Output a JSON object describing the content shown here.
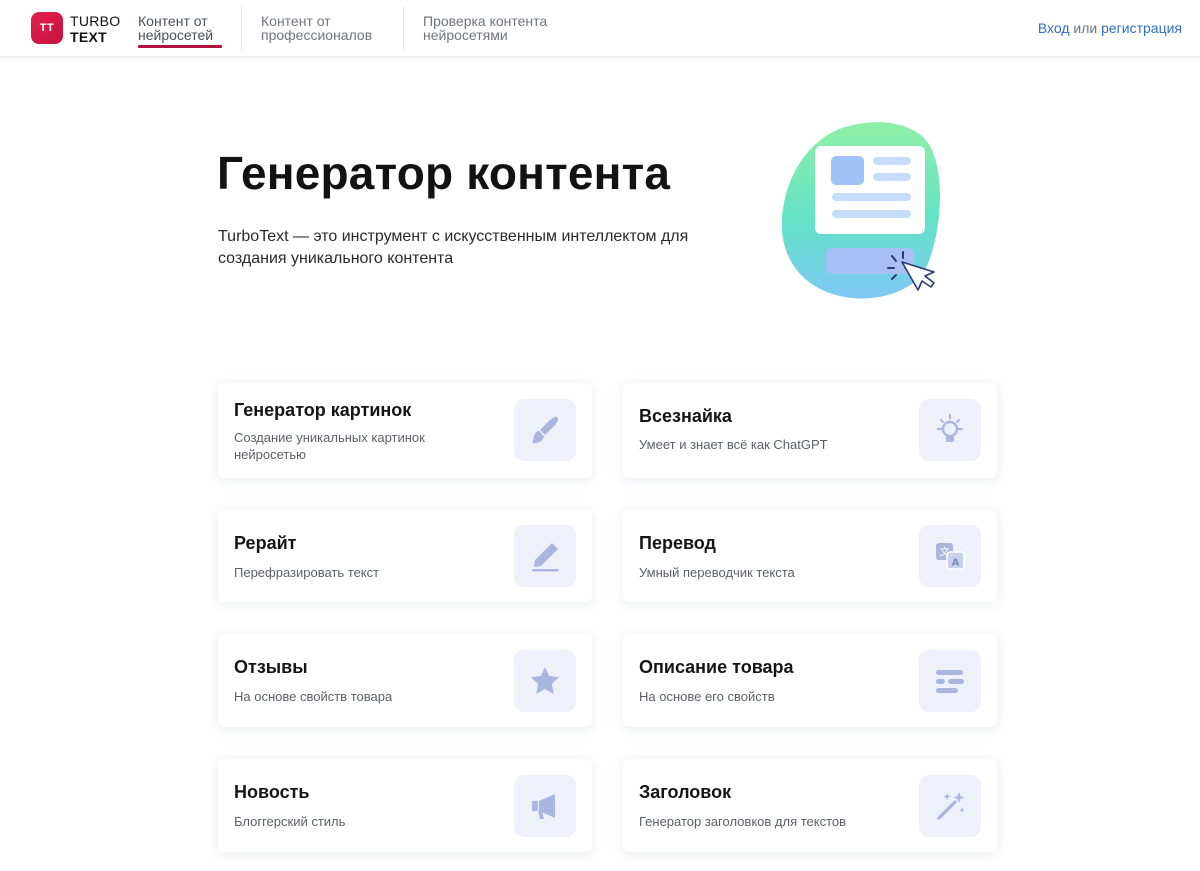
{
  "header": {
    "logo": {
      "mark": "TT",
      "line1": "TURBO",
      "line2": "TEXT"
    },
    "nav": [
      {
        "line1": "Контент от",
        "line2": "нейросетей",
        "active": true
      },
      {
        "line1": "Контент от",
        "line2": "профессионалов",
        "active": false
      },
      {
        "line1": "Проверка контента",
        "line2": "нейросетями",
        "active": false
      }
    ],
    "auth": {
      "login": "Вход",
      "or": "или",
      "register": "регистрация"
    }
  },
  "hero": {
    "title": "Генератор контента",
    "subtitle": "TurboText — это инструмент с искусственным интеллектом для создания уникального контента"
  },
  "cards": [
    {
      "title": "Генератор картинок",
      "description": "Создание уникальных картинок нейросетью",
      "icon": "paintbrush-icon"
    },
    {
      "title": "Всезнайка",
      "description": "Умеет и знает всё как ChatGPT",
      "icon": "lightbulb-icon"
    },
    {
      "title": "Рерайт",
      "description": "Перефразировать текст",
      "icon": "pencil-icon"
    },
    {
      "title": "Перевод",
      "description": "Умный переводчик текста",
      "icon": "translate-icon"
    },
    {
      "title": "Отзывы",
      "description": "На основе свойств товара",
      "icon": "star-icon"
    },
    {
      "title": "Описание товара",
      "description": "На основе его свойств",
      "icon": "text-lines-icon"
    },
    {
      "title": "Новость",
      "description": "Блоггерский стиль",
      "icon": "megaphone-icon"
    },
    {
      "title": "Заголовок",
      "description": "Генератор заголовков для текстов",
      "icon": "magic-wand-icon"
    }
  ],
  "colors": {
    "brand": "#c5123f",
    "link": "#2f6fc4",
    "icon_bg": "#eef1f9",
    "icon_fg": "#a8b6e0"
  }
}
